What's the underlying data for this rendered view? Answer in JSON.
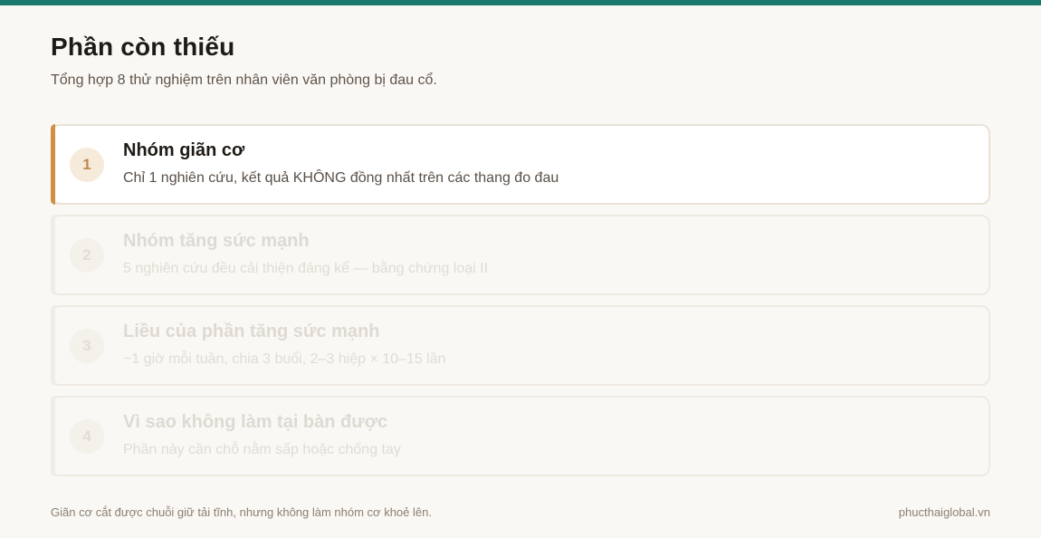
{
  "header": {
    "title": "Phần còn thiếu",
    "subtitle": "Tổng hợp 8 thử nghiệm trên nhân viên văn phòng bị đau cổ."
  },
  "steps": [
    {
      "number": "1",
      "title": "Nhóm giãn cơ",
      "desc": "Chỉ 1 nghiên cứu, kết quả KHÔNG đồng nhất trên các thang đo đau",
      "state": "active"
    },
    {
      "number": "2",
      "title": "Nhóm tăng sức mạnh",
      "desc": "5 nghiên cứu đều cải thiện đáng kể — bằng chứng loại II",
      "state": "dimmed"
    },
    {
      "number": "3",
      "title": "Liều của phần tăng sức mạnh",
      "desc": "~1 giờ mỗi tuần, chia 3 buổi, 2–3 hiệp × 10–15 lần",
      "state": "dimmed"
    },
    {
      "number": "4",
      "title": "Vì sao không làm tại bàn được",
      "desc": "Phần này cần chỗ nằm sấp hoặc chống tay",
      "state": "dimmed"
    }
  ],
  "footer": {
    "note": "Giãn cơ cắt được chuỗi giữ tải tĩnh, nhưng không làm nhóm cơ khoẻ lên.",
    "site": "phucthaiglobal.vn"
  },
  "colors": {
    "topbar": "#1a7a6e",
    "accent": "#cf8f45",
    "background": "#faf8f4"
  }
}
